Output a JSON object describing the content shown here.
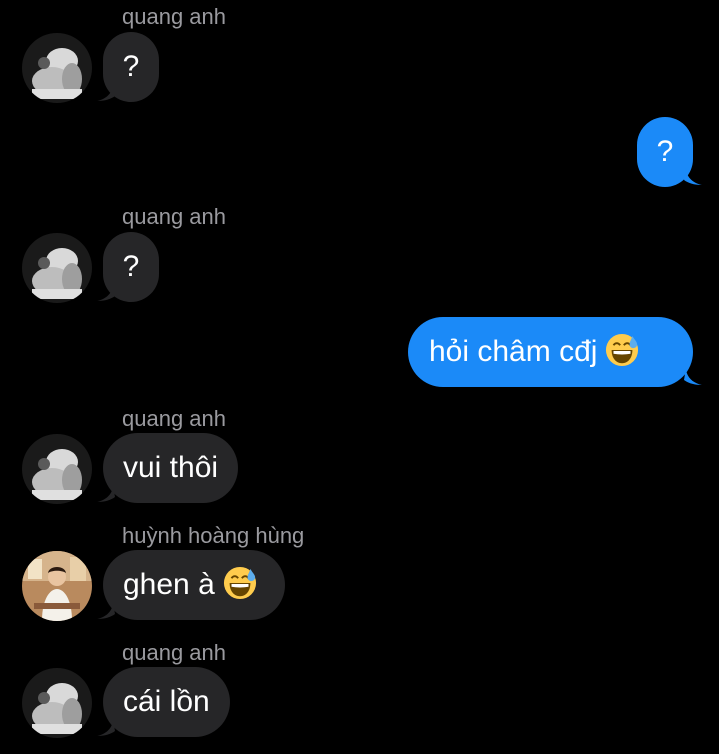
{
  "conversation": {
    "messages": [
      {
        "sender": "quang anh",
        "text": "?",
        "direction": "incoming"
      },
      {
        "text": "?",
        "direction": "outgoing"
      },
      {
        "sender": "quang anh",
        "text": "?",
        "direction": "incoming"
      },
      {
        "text": "hỏi châm cđj",
        "emoji": "grinning-face-with-sweat",
        "direction": "outgoing"
      },
      {
        "sender": "quang anh",
        "text": "vui thôi",
        "direction": "incoming"
      },
      {
        "sender": "huỳnh hoàng hùng",
        "text": "ghen à",
        "emoji": "grinning-face-with-sweat",
        "direction": "incoming"
      },
      {
        "sender": "quang anh",
        "text": "cái lồn",
        "direction": "incoming"
      }
    ]
  },
  "colors": {
    "background": "#000000",
    "incoming_bubble": "#262628",
    "outgoing_bubble": "#1b8af8",
    "sender_name": "#9a9a9f",
    "message_text": "#ffffff"
  }
}
